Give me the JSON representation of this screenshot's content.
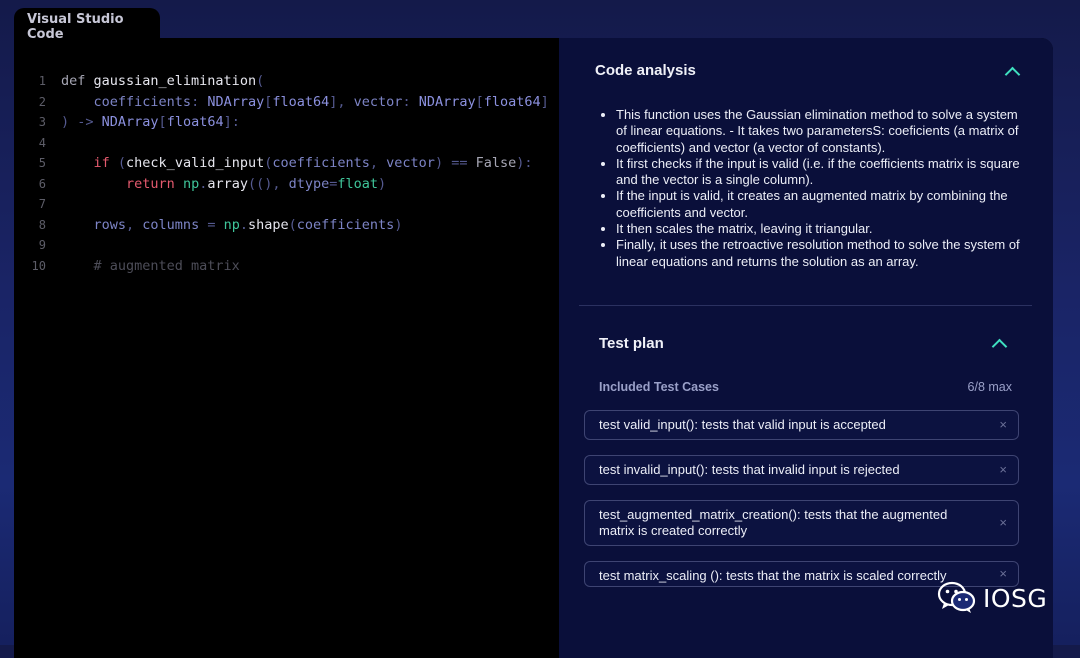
{
  "window": {
    "title": "Visual Studio Code"
  },
  "editor": {
    "lines": [
      {
        "n": "1",
        "tokens": [
          [
            "kw",
            "def "
          ],
          [
            "fn",
            "gaussian_elimination"
          ],
          [
            "pu",
            "("
          ]
        ]
      },
      {
        "n": "2",
        "tokens": [
          [
            "wh",
            "    "
          ],
          [
            "par",
            "coefficients"
          ],
          [
            "pu",
            ": "
          ],
          [
            "ty",
            "NDArray"
          ],
          [
            "pu",
            "["
          ],
          [
            "ty",
            "float64"
          ],
          [
            "pu",
            "], "
          ],
          [
            "par",
            "vector"
          ],
          [
            "pu",
            ": "
          ],
          [
            "ty",
            "NDArray"
          ],
          [
            "pu",
            "["
          ],
          [
            "ty",
            "float64"
          ],
          [
            "pu",
            "]"
          ]
        ]
      },
      {
        "n": "3",
        "tokens": [
          [
            "pu",
            ") -> "
          ],
          [
            "ty",
            "NDArray"
          ],
          [
            "pu",
            "["
          ],
          [
            "ty",
            "float64"
          ],
          [
            "pu",
            "]:"
          ]
        ]
      },
      {
        "n": "4",
        "tokens": []
      },
      {
        "n": "5",
        "tokens": [
          [
            "wh",
            "    "
          ],
          [
            "red",
            "if "
          ],
          [
            "pu",
            "("
          ],
          [
            "fn",
            "check_valid_input"
          ],
          [
            "pu",
            "("
          ],
          [
            "par",
            "coefficients"
          ],
          [
            "pu",
            ", "
          ],
          [
            "par",
            "vector"
          ],
          [
            "pu",
            ") "
          ],
          [
            "pu",
            "== "
          ],
          [
            "kw",
            "False"
          ],
          [
            "pu",
            "):"
          ]
        ]
      },
      {
        "n": "6",
        "tokens": [
          [
            "wh",
            "        "
          ],
          [
            "red",
            "return "
          ],
          [
            "grn",
            "np"
          ],
          [
            "pu",
            "."
          ],
          [
            "fn",
            "array"
          ],
          [
            "pu",
            "((), "
          ],
          [
            "par",
            "dtype"
          ],
          [
            "pu",
            "="
          ],
          [
            "grn",
            "float"
          ],
          [
            "pu",
            ")"
          ]
        ]
      },
      {
        "n": "7",
        "tokens": []
      },
      {
        "n": "8",
        "tokens": [
          [
            "wh",
            "    "
          ],
          [
            "par",
            "rows"
          ],
          [
            "pu",
            ", "
          ],
          [
            "par",
            "columns"
          ],
          [
            "pu",
            " = "
          ],
          [
            "grn",
            "np"
          ],
          [
            "pu",
            "."
          ],
          [
            "fn",
            "shape"
          ],
          [
            "pu",
            "("
          ],
          [
            "par",
            "coefficients"
          ],
          [
            "pu",
            ")"
          ]
        ]
      },
      {
        "n": "9",
        "tokens": []
      },
      {
        "n": "10",
        "tokens": [
          [
            "wh",
            "    "
          ],
          [
            "cm",
            "# augmented matrix"
          ]
        ]
      }
    ]
  },
  "analysis": {
    "title": "Code analysis",
    "bullets": [
      "This function uses the Gaussian elimination method to solve a system of linear equations. - It takes two parametersS: coeficients (a matrix of coefficients) and vector (a vector of constants).",
      "It first checks if the input is valid (i.e. if the coefficients matrix is square and the vector is a single column).",
      "If the input is valid, it creates an augmented matrix by combining the coefficients and vector.",
      "It then scales the matrix, leaving it triangular.",
      "Finally, it uses the retroactive resolution method to solve the system of linear equations and returns the solution as an array."
    ]
  },
  "test_plan": {
    "title": "Test plan",
    "included_label": "Included Test Cases",
    "count": "6/8 max",
    "cases": [
      "test valid_input(): tests that valid input is accepted",
      "test invalid_input(): tests that invalid input is rejected",
      "test_augmented_matrix_creation(): tests that the augmented matrix is created correctly",
      "test matrix_scaling (): tests that the matrix is scaled correctly"
    ],
    "remove_symbol": "×"
  },
  "watermark": {
    "text": "IOSG",
    "icon": "wechat-icon"
  },
  "colors": {
    "accent": "#3fe0c0",
    "panel_bg": "#0a0f3a",
    "editor_bg": "#000000"
  }
}
